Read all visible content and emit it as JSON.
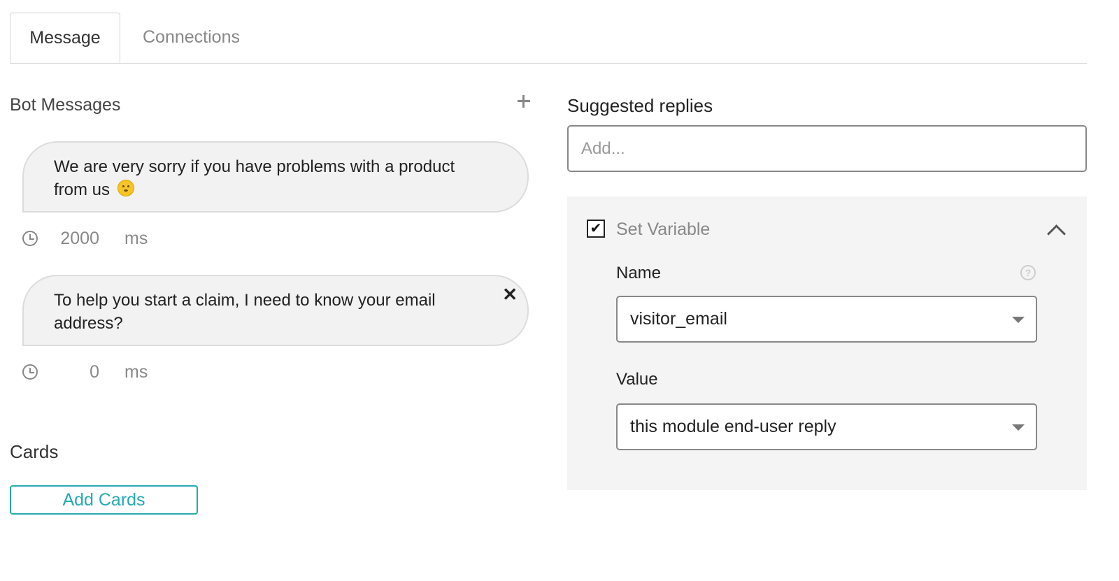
{
  "tabs": [
    {
      "label": "Message",
      "active": true
    },
    {
      "label": "Connections",
      "active": false
    }
  ],
  "bot_messages": {
    "title": "Bot Messages",
    "add_icon": "plus-icon",
    "messages": [
      {
        "line1": "We are very sorry if you have problems with a product",
        "line2": "from us",
        "emoji": "neutral-face-emoji",
        "delay": "2000",
        "unit": "ms"
      },
      {
        "line1": "To help you start a claim, I need to know your email",
        "line2": "address?",
        "close": "✕",
        "delay": "0",
        "unit": "ms"
      }
    ]
  },
  "cards": {
    "title": "Cards",
    "button_label": "Add Cards"
  },
  "suggested_replies": {
    "title": "Suggested replies",
    "placeholder": "Add..."
  },
  "set_variable": {
    "checked": true,
    "check_mark": "✔",
    "label": "Set Variable",
    "name_label": "Name",
    "name_value": "visitor_email",
    "help_glyph": "?",
    "value_label": "Value",
    "value_value": "this module end-user reply"
  },
  "colors": {
    "accent": "#25aab3",
    "panel_bg": "#f4f4f4",
    "bubble_bg": "#f2f2f2"
  }
}
